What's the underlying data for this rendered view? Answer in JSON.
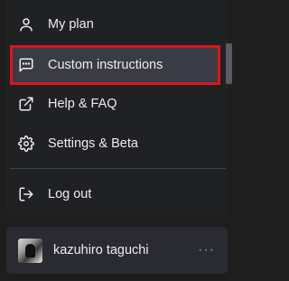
{
  "menu": {
    "items": [
      {
        "label": "My plan",
        "icon": "user-icon"
      },
      {
        "label": "Custom instructions",
        "icon": "message-square-icon"
      },
      {
        "label": "Help & FAQ",
        "icon": "external-link-icon"
      },
      {
        "label": "Settings & Beta",
        "icon": "gear-icon"
      }
    ],
    "logout_label": "Log out",
    "highlight_color": "#e0141c"
  },
  "user": {
    "name": "kazuhiro taguchi",
    "more_glyph": "···"
  }
}
